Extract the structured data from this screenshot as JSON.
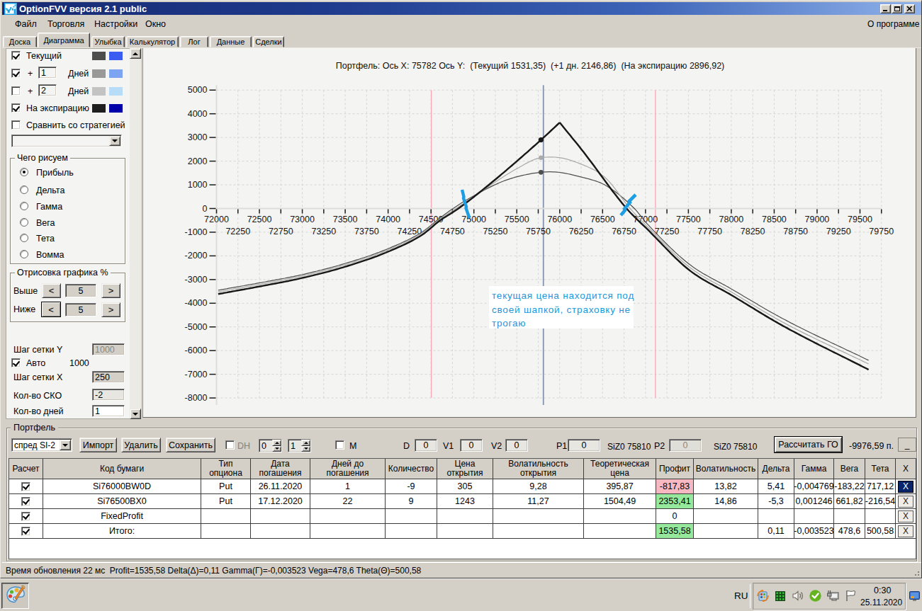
{
  "window": {
    "title": "OptionFVV версия 2.1 public",
    "controls": {
      "minimize": "minimize",
      "maximize": "maximize",
      "close": "close"
    }
  },
  "menu": {
    "items": [
      "Файл",
      "Торговля",
      "Настройки",
      "Окно"
    ],
    "about": "О программе"
  },
  "tabs": {
    "items": [
      "Доска",
      "Диаграмма",
      "Улыбка",
      "Калькулятор",
      "Лог",
      "Данные",
      "Сделки"
    ],
    "active": "Диаграмма"
  },
  "sidebar": {
    "rows": [
      {
        "checked": true,
        "label": "Текущий",
        "swatch_gray": "#4d4d4d",
        "swatch_blue": "#3a5cf0"
      },
      {
        "checked": true,
        "plus": "+",
        "value": "1",
        "label": "Дней",
        "swatch_gray": "#999999",
        "swatch_blue": "#7da4f0"
      },
      {
        "checked": false,
        "plus": "+",
        "value": "2",
        "label": "Дней",
        "swatch_gray": "#c3c3c3",
        "swatch_blue": "#b7dcf8"
      },
      {
        "checked": true,
        "label": "На экспирацию",
        "swatch_gray": "#1e1e1e",
        "swatch_blue": "#0000a8"
      },
      {
        "checked": false,
        "label": "Сравнить со стратегией"
      }
    ],
    "strategy_dropdown_value": "",
    "draw_group": {
      "title": "Чего рисуем",
      "options": [
        "Прибыль",
        "Дельта",
        "Гамма",
        "Вега",
        "Тета",
        "Вомма"
      ],
      "selected": "Прибыль"
    },
    "render_group": {
      "title": "Отрисовка графика %",
      "above_label": "Выше",
      "above_value": "5",
      "below_label": "Ниже",
      "below_value": "5",
      "dec_label": "<",
      "inc_label": ">"
    },
    "grid_y_label": "Шаг сетки Y",
    "grid_y_value": "1000",
    "auto_label": "Авто",
    "auto_checked": true,
    "auto_value": "1000",
    "grid_x_label": "Шаг сетки X",
    "grid_x_value": "250",
    "sko_label": "Кол-во СКО",
    "sko_value": "-2",
    "days_label": "Кол-во дней",
    "days_value": "1"
  },
  "chart_data": {
    "type": "line",
    "title": "Портфель: Ось X: 75782 Ось Y:  (Текущий 1531,35)  (+1 дн. 2146,86)  (На экспирацию 2896,92)",
    "xlim": [
      72000,
      79750
    ],
    "ylim": [
      -8000,
      5000
    ],
    "x_tick_step": 250,
    "x_label_step": 500,
    "y_tick_step": 1000,
    "grid": true,
    "series": [
      {
        "name": "Текущий",
        "color": "#4e4e4e",
        "width": 1.2,
        "points": [
          [
            72020,
            -3450
          ],
          [
            72500,
            -3140
          ],
          [
            73000,
            -2790
          ],
          [
            73500,
            -2320
          ],
          [
            74000,
            -1695
          ],
          [
            74400,
            -985
          ],
          [
            74600,
            -415
          ],
          [
            74756,
            0
          ],
          [
            75100,
            740
          ],
          [
            75400,
            1230
          ],
          [
            75782,
            1531
          ],
          [
            75900,
            1548
          ],
          [
            76249,
            1330
          ],
          [
            76536,
            975
          ],
          [
            76870,
            0
          ],
          [
            77026,
            -672
          ],
          [
            77510,
            -2350
          ],
          [
            78003,
            -3400
          ],
          [
            78600,
            -4650
          ],
          [
            79600,
            -6410
          ]
        ]
      },
      {
        "name": "+1 Дней",
        "color": "#a9a9a9",
        "width": 1.2,
        "points": [
          [
            72020,
            -3520
          ],
          [
            72500,
            -3205
          ],
          [
            73000,
            -2848
          ],
          [
            73500,
            -2375
          ],
          [
            74000,
            -1745
          ],
          [
            74400,
            -1030
          ],
          [
            74600,
            -455
          ],
          [
            74792,
            0
          ],
          [
            75150,
            880
          ],
          [
            75500,
            1680
          ],
          [
            75782,
            2147
          ],
          [
            75914,
            2170
          ],
          [
            76249,
            1875
          ],
          [
            76536,
            1285
          ],
          [
            76820,
            0
          ],
          [
            77026,
            -780
          ],
          [
            77510,
            -2470
          ],
          [
            78003,
            -3530
          ],
          [
            78600,
            -4800
          ],
          [
            79600,
            -6565
          ]
        ]
      },
      {
        "name": "На экспирацию",
        "color": "#181818",
        "width": 2.4,
        "peak_x": 76000,
        "points": [
          [
            72020,
            -3610
          ],
          [
            72500,
            -3293
          ],
          [
            73000,
            -2933
          ],
          [
            73500,
            -2458
          ],
          [
            74000,
            -1823
          ],
          [
            74400,
            -1103
          ],
          [
            74600,
            -520
          ],
          [
            74820,
            0
          ],
          [
            75250,
            1226
          ],
          [
            75782,
            2897
          ],
          [
            76000,
            3630
          ],
          [
            76266,
            2440
          ],
          [
            76780,
            0
          ],
          [
            77026,
            -891
          ],
          [
            77510,
            -2600
          ],
          [
            78003,
            -3660
          ],
          [
            78600,
            -4950
          ],
          [
            79600,
            -6804
          ]
        ]
      }
    ],
    "markers": [
      {
        "x": 75782,
        "y": 2896.92,
        "color": "#181818",
        "r": 3.6
      },
      {
        "x": 75782,
        "y": 2146.86,
        "color": "#ababab",
        "r": 3.2
      },
      {
        "x": 75782,
        "y": 1531.35,
        "color": "#4e4e4e",
        "r": 3.4
      }
    ],
    "vlines": [
      {
        "x": 75810,
        "color": "#8695ad",
        "w": 1.8,
        "full": true
      },
      {
        "x": 74504,
        "color": "#f9a9bb",
        "w": 1.4,
        "full": false
      },
      {
        "x": 77116,
        "color": "#f9a9bb",
        "w": 1.4,
        "full": false
      }
    ],
    "annotation": {
      "lines": [
        "текущая цена находится под",
        "своей шапкой, страховку не",
        "трогаю"
      ],
      "color": "#1899dc"
    },
    "legend_position": "none"
  },
  "portfolio": {
    "group_title": "Портфель",
    "preset_value": "спред SI-2",
    "import_label": "Импорт",
    "delete_label": "Удалить",
    "save_label": "Сохранить",
    "dh_label": "DH",
    "dh_spin1": "0",
    "dh_spin2": "1",
    "m_label": "M",
    "d_label": "D",
    "d_value": "0",
    "v1_label": "V1",
    "v1_value": "0",
    "v2_label": "V2",
    "v2_value": "0",
    "p1_label": "P1",
    "p1_value": "0",
    "p1_ticker": "SiZ0 75810",
    "p2_label": "P2",
    "p2_value": "0",
    "p2_ticker": "SiZ0 75810",
    "calc_label": "Рассчитать ГО",
    "margin_value": "-9976,59 п.",
    "min_label": "_",
    "table": {
      "columns": [
        "Расчет",
        "Код бумаги",
        "Тип\nопциона",
        "Дата\nпогашения",
        "Дней до\nпогашения",
        "Количество",
        "Цена\nоткрытия",
        "Волатильность\nоткрытия",
        "Теоретическая\nцена",
        "Профит",
        "Волатильность",
        "Дельта",
        "Гамма",
        "Вега",
        "Тета",
        "X"
      ],
      "rows": [
        {
          "checked": true,
          "cells": [
            "Si76000BW0D",
            "Put",
            "26.11.2020",
            "1",
            "-9",
            "305",
            "9,28",
            "395,87",
            "-817,83",
            "13,82",
            "5,41",
            "-0,004769",
            "-183,22",
            "717,12"
          ],
          "profit": "loss",
          "x_selected": true
        },
        {
          "checked": true,
          "cells": [
            "Si76500BX0",
            "Put",
            "17.12.2020",
            "22",
            "9",
            "1243",
            "11,27",
            "1504,49",
            "2353,41",
            "14,86",
            "-5,3",
            "0,001246",
            "661,82",
            "-216,54"
          ],
          "profit": "gain",
          "x_selected": false
        },
        {
          "checked": true,
          "cells": [
            "FixedProfit",
            "",
            "",
            "",
            "",
            "",
            "",
            "",
            "0",
            "",
            "",
            "",
            "",
            ""
          ],
          "profit": "none",
          "x_selected": false
        },
        {
          "checked": true,
          "cells": [
            "Итого:",
            "",
            "",
            "",
            "",
            "",
            "",
            "",
            "1535,58",
            "",
            "0,11",
            "-0,003523",
            "478,6",
            "500,58"
          ],
          "profit": "gain",
          "x_selected": false
        }
      ],
      "loss_bg": "#f7b8c2",
      "gain_bg": "#96e89c",
      "x_label": "X"
    }
  },
  "statusbar": {
    "text": "Время обновления 22 мс  Profit=1535,58 Delta(Δ)=0,11 Gamma(Γ)=-0,003523 Vega=478,6 Theta(Θ)=500,58"
  },
  "taskbar": {
    "lang": "RU",
    "time": "0:30",
    "date": "25.11.2020",
    "app_button": "paint",
    "tray_icons": [
      "windows-update-icon",
      "green-grid-icon",
      "volume-icon",
      "antivirus-check-icon",
      "network-icon",
      "flag-icon"
    ]
  }
}
